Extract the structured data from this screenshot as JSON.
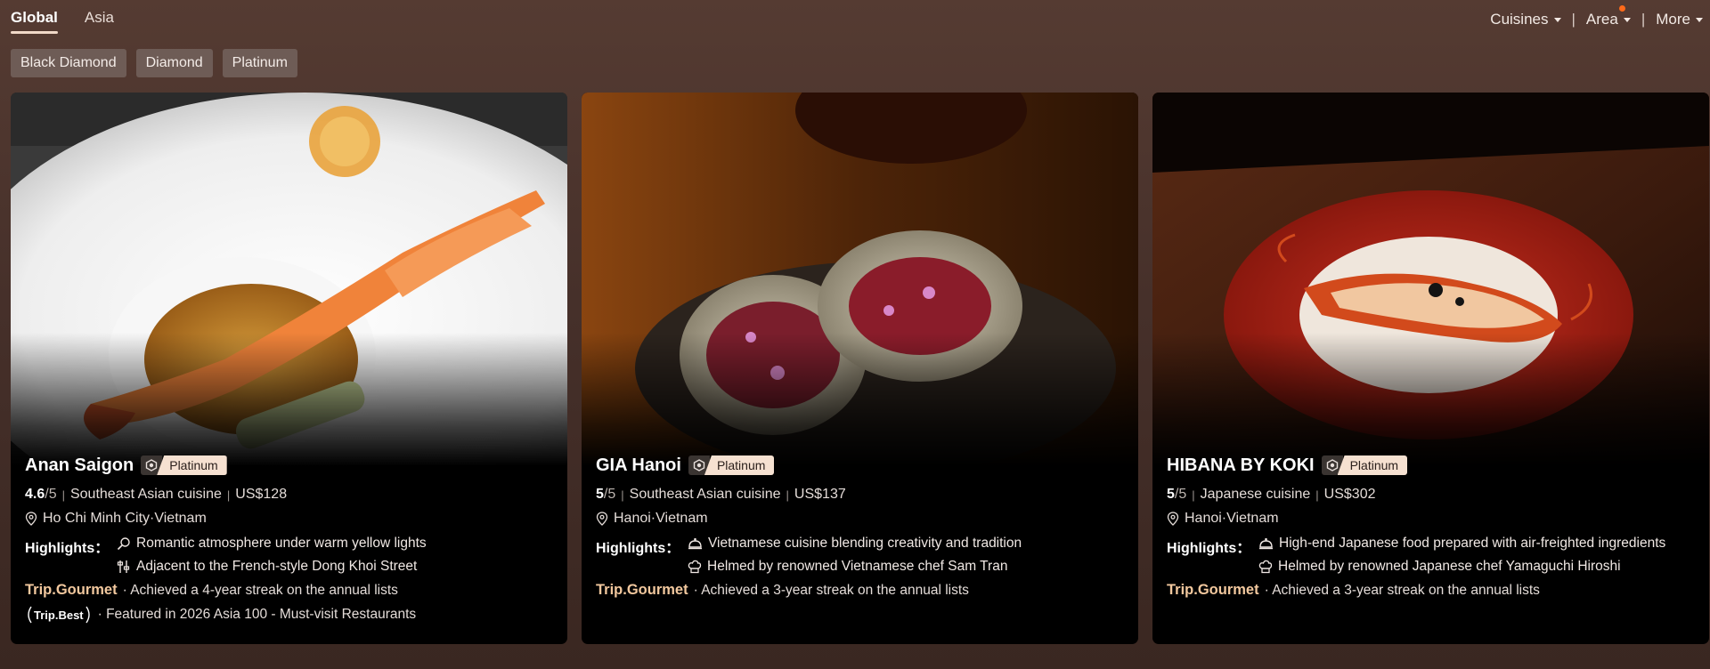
{
  "nav": {
    "tabs": [
      {
        "label": "Global",
        "active": true
      },
      {
        "label": "Asia",
        "active": false
      }
    ],
    "filters": {
      "cuisines": "Cuisines",
      "area": "Area",
      "more": "More",
      "separator": "|"
    }
  },
  "chips": [
    "Black Diamond",
    "Diamond",
    "Platinum"
  ],
  "labels": {
    "highlights": "Highlights：",
    "out_of": "/5",
    "divider": "|",
    "brand": "Trip.Gourmet",
    "best_brand": "Trip.Best"
  },
  "cards": [
    {
      "name": "Anan Saigon",
      "tier": "Platinum",
      "score": "4.6",
      "cuisine": "Southeast Asian cuisine",
      "price": "US$128",
      "location": "Ho Chi Minh City·Vietnam",
      "highlights": [
        {
          "icon": "magnifier-icon",
          "text": "Romantic atmosphere under warm yellow lights"
        },
        {
          "icon": "street-sign-icon",
          "text": "Adjacent to the French-style Dong Khoi Street"
        }
      ],
      "gourmet_text": "· Achieved a 4-year streak on the annual lists",
      "best_text": "· Featured in 2026 Asia 100 - Must-visit Restaurants"
    },
    {
      "name": "GIA Hanoi",
      "tier": "Platinum",
      "score": "5",
      "cuisine": "Southeast Asian cuisine",
      "price": "US$137",
      "location": "Hanoi·Vietnam",
      "highlights": [
        {
          "icon": "cloche-icon",
          "text": "Vietnamese cuisine blending creativity and tradition"
        },
        {
          "icon": "chef-hat-icon",
          "text": "Helmed by renowned Vietnamese chef Sam Tran"
        }
      ],
      "gourmet_text": "· Achieved a 3-year streak on the annual lists"
    },
    {
      "name": "HIBANA BY KOKI",
      "tier": "Platinum",
      "score": "5",
      "cuisine": "Japanese cuisine",
      "price": "US$302",
      "location": "Hanoi·Vietnam",
      "highlights": [
        {
          "icon": "cloche-icon",
          "text": "High-end Japanese food prepared with air-freighted ingredients"
        },
        {
          "icon": "chef-hat-icon",
          "text": "Helmed by renowned Japanese chef Yamaguchi Hiroshi"
        }
      ],
      "gourmet_text": "· Achieved a 3-year streak on the annual lists"
    }
  ]
}
